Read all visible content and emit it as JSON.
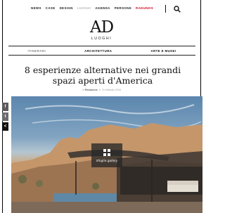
{
  "nav": {
    "items": [
      "NEWS",
      "CASE",
      "DESIGN",
      "LUOGHI",
      "AGENDA",
      "PERSONE",
      "RADUNOS"
    ]
  },
  "logo": {
    "mark": "AD",
    "subtitle": "LUOGHI"
  },
  "categories": [
    "ITINERARI",
    "ARCHITETTURA",
    "ARTE E MUSEI"
  ],
  "article": {
    "title": "8 esperienze alternative nei grandi spazi aperti d'America",
    "author_prefix": "di",
    "author": "Redazione",
    "date": "21 febbraio 2018"
  },
  "social": {
    "fb": "f",
    "tw": "t",
    "more": "<"
  },
  "gallery": {
    "label": "Sfoglia gallery"
  },
  "colors": {
    "accent": "#d0021b",
    "muted": "#b5b5b5"
  }
}
